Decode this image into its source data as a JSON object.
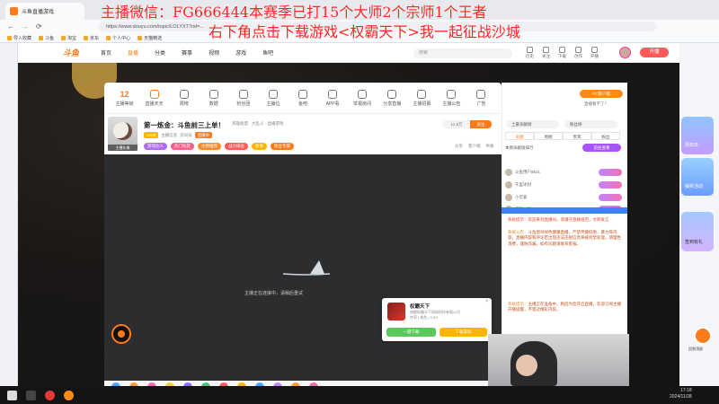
{
  "browser": {
    "tab_title": "斗鱼直播游戏",
    "url": "https://www.douyu.com/topic/LOLYXT?rid=...",
    "bookmarks": [
      "导入收藏",
      "斗鱼",
      "淘宝",
      "京东",
      "个人中心",
      "天猫精选"
    ]
  },
  "overlay": {
    "line1": "主播微信：FG666444本赛季已打15个大师2个宗师1个王者",
    "line2": "右下角点击下载游戏<权霸天下>我一起征战沙城"
  },
  "site_header": {
    "logo": "斗鱼",
    "nav": [
      "首页",
      "直播",
      "分类",
      "赛事",
      "视频",
      "游戏",
      "鱼吧"
    ],
    "search_placeholder": "搜索",
    "icons": [
      "历史",
      "关注",
      "下载",
      "创作",
      "开播"
    ],
    "open_button": "开播"
  },
  "category_bar": {
    "items": [
      {
        "label": "主播等级",
        "value": "12"
      },
      {
        "label": "直播天天",
        "value": ""
      },
      {
        "label": "周榜",
        "value": ""
      },
      {
        "label": "数据",
        "value": ""
      },
      {
        "label": "粉丝团",
        "value": ""
      },
      {
        "label": "主播位",
        "value": ""
      },
      {
        "label": "鱼吧",
        "value": ""
      },
      {
        "label": "APP看",
        "value": ""
      },
      {
        "label": "举报房间",
        "value": ""
      },
      {
        "label": "分享直播",
        "value": ""
      },
      {
        "label": "主播招募",
        "value": ""
      },
      {
        "label": "主播公告",
        "value": ""
      },
      {
        "label": "广告",
        "value": ""
      }
    ]
  },
  "room": {
    "avatar_label": "主播头像",
    "title": "第一炼金：斗鱼前三上单！",
    "meta": "英雄联盟 · 大乱斗 · 直播游戏",
    "row2": [
      "LV38",
      "主播信息",
      "房间号",
      "直播中"
    ],
    "tags": [
      "游戏达人",
      "热门标签",
      "大神推荐",
      "战力排名",
      "新秀",
      "粉丝专属"
    ],
    "follower_count": "11.9万",
    "follow_label": "关注",
    "share": [
      "分享",
      "客户端",
      "举报"
    ]
  },
  "video": {
    "loading_text": "主播正在连接中，请稍后重试"
  },
  "game_popup": {
    "name": "权霸天下",
    "company": "成都权霸天下网络科技有限公司",
    "meta": "传奇 | 角色 | 3.0G",
    "btn_primary": "一键下载",
    "btn_secondary": "下载游戏"
  },
  "side_panel": {
    "pc_button": "PC客户端",
    "pc_sub": "直播看不了？",
    "rank_buttons": [
      "土豪贡献榜",
      "粉丝榜"
    ],
    "tabs": [
      "贡献",
      "周榜",
      "贵宾",
      "粉丝"
    ],
    "note": "本周贡献值排行",
    "badge": "前往查看",
    "ranking": [
      {
        "name": "斗鱼用户8521"
      },
      {
        "name": "千里冰封"
      },
      {
        "name": "小可爱"
      },
      {
        "name": "爱就一起"
      }
    ],
    "chat_notice": "系统提示：欢迎来到直播间，请遵守直播规范，文明发言",
    "chat": [
      {
        "name": "系统公告：",
        "text": "斗鱼倡导绿色健康直播，严禁传播低俗、暴力等内容，直播内容和评论若出现违法违规信息将被封禁处理，请理性消费，谨防诈骗，如有问题请联系客服。"
      },
      {
        "name": "系统提示：",
        "text": "主播正在准备中，稍后为您开启直播，欢迎订阅主播开播提醒，不错过精彩内容。"
      }
    ]
  },
  "right_ads": [
    "周年庆",
    "抽奖活动",
    "签到有礼"
  ],
  "float_button": "回到顶部",
  "taskbar": {
    "time": "17:18",
    "date": "2024/11/28"
  }
}
